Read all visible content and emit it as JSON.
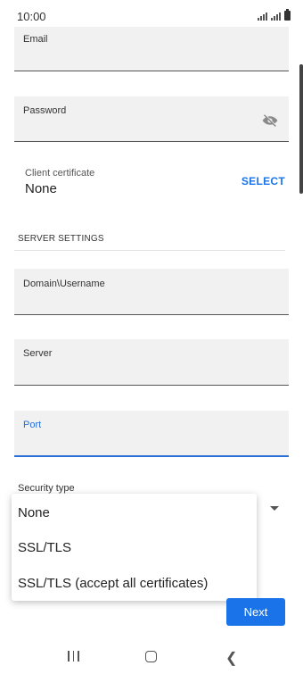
{
  "status_bar": {
    "time": "10:00"
  },
  "form": {
    "email_label": "Email",
    "password_label": "Password",
    "client_certificate": {
      "label": "Client certificate",
      "value": "None",
      "select_label": "SELECT"
    },
    "server_settings_header": "SERVER SETTINGS",
    "domain_username_label": "Domain\\Username",
    "server_label": "Server",
    "port_label": "Port",
    "security_type_label": "Security type"
  },
  "security_menu": {
    "options": [
      "None",
      "SSL/TLS",
      "SSL/TLS (accept all certificates)"
    ]
  },
  "actions": {
    "next_label": "Next"
  },
  "colors": {
    "accent": "#1a73e8",
    "focus": "#2a6fd6",
    "field_bg": "#f1f1f1"
  },
  "icons": {
    "password_toggle": "eye-off-icon",
    "dropdown": "dropdown-arrow-icon"
  }
}
